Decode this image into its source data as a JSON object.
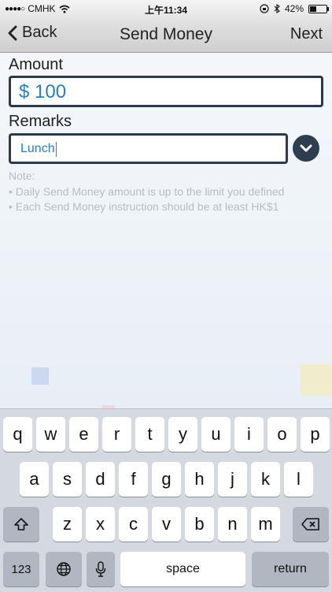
{
  "status": {
    "carrier": "CMHK",
    "time": "上午11:34",
    "battery": "42%"
  },
  "nav": {
    "back_label": "Back",
    "title": "Send Money",
    "next_label": "Next"
  },
  "form": {
    "amount_label": "Amount",
    "amount_value": "$ 100",
    "remarks_label": "Remarks",
    "remarks_value": "Lunch"
  },
  "notes": {
    "heading": "Note:",
    "lines": [
      "• Daily Send Money amount is up to the limit you defined",
      "• Each Send Money instruction should be at least HK$1"
    ]
  },
  "keyboard": {
    "row1": [
      "q",
      "w",
      "e",
      "r",
      "t",
      "y",
      "u",
      "i",
      "o",
      "p"
    ],
    "row2": [
      "a",
      "s",
      "d",
      "f",
      "g",
      "h",
      "j",
      "k",
      "l"
    ],
    "row3": [
      "z",
      "x",
      "c",
      "v",
      "b",
      "n",
      "m"
    ],
    "numbers_label": "123",
    "space_label": "space",
    "return_label": "return"
  }
}
